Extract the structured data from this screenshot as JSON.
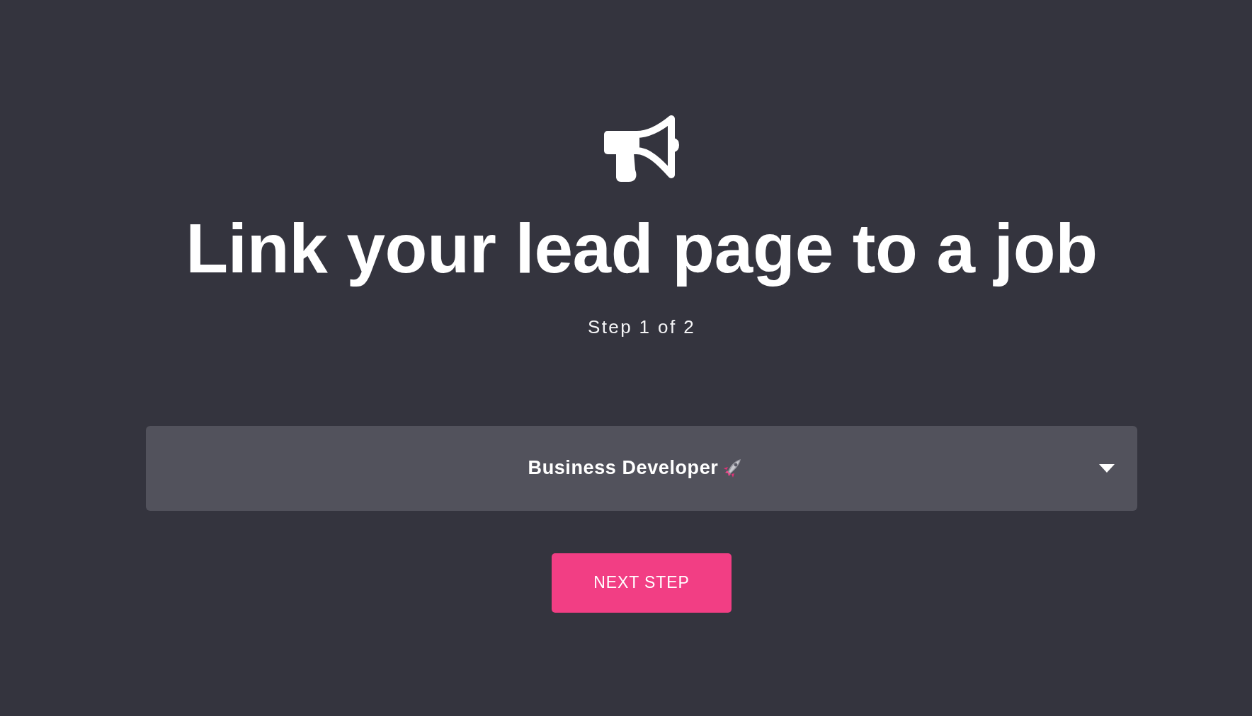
{
  "header": {
    "title": "Link your lead page to a job",
    "step": "Step 1 of 2"
  },
  "job_select": {
    "value": "Business Developer"
  },
  "next_button": {
    "label": "NEXT STEP"
  }
}
